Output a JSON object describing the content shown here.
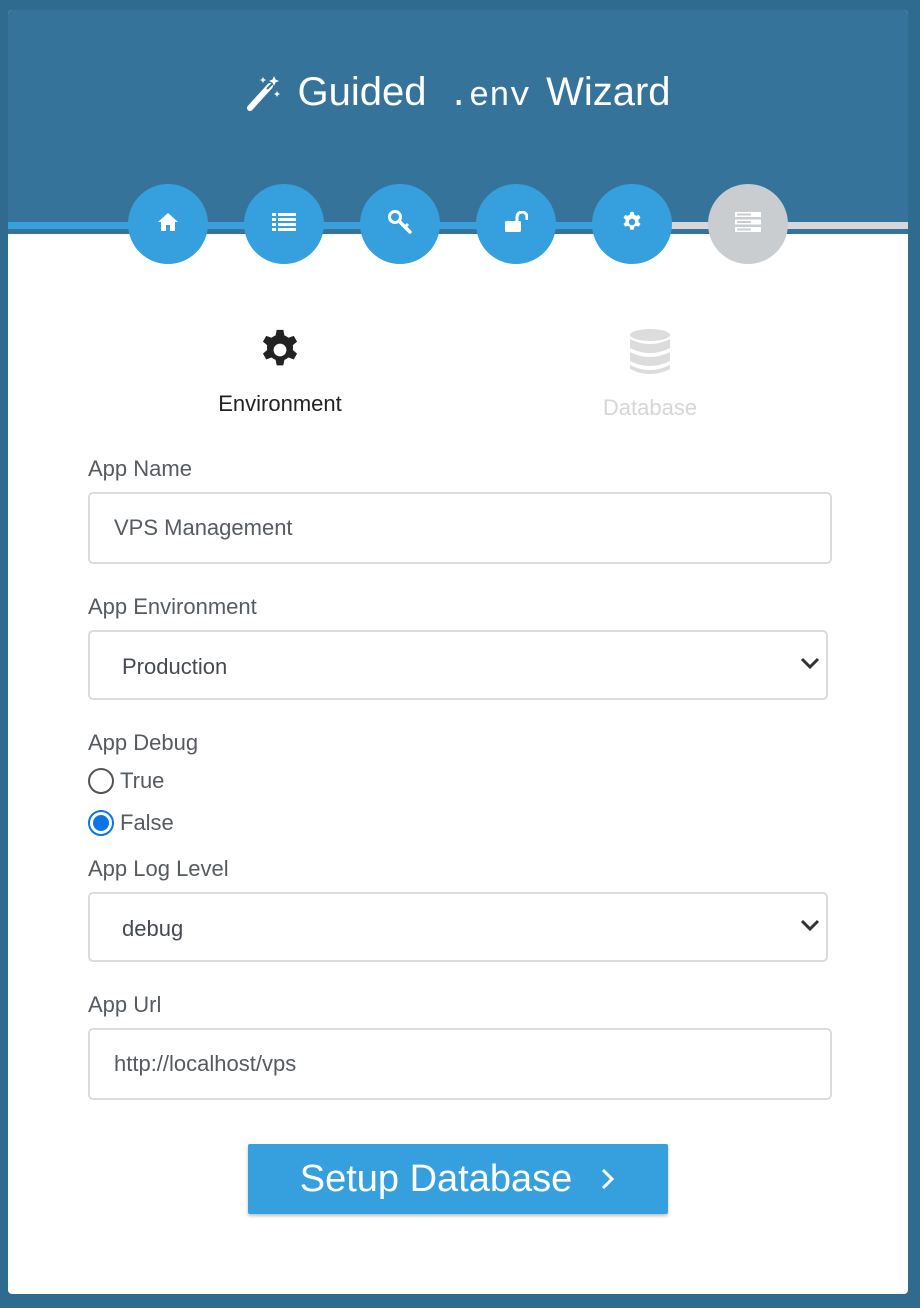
{
  "header": {
    "title_prefix": "Guided",
    "title_env": ".env",
    "title_suffix": "Wizard",
    "wand_icon": "magic-wand-icon"
  },
  "progress": {
    "completed_color": "#3aa0dc",
    "pending_color": "#d5d8da",
    "steps": [
      {
        "icon": "home-icon",
        "state": "done"
      },
      {
        "icon": "list-icon",
        "state": "done"
      },
      {
        "icon": "key-icon",
        "state": "done"
      },
      {
        "icon": "unlock-icon",
        "state": "done"
      },
      {
        "icon": "gear-icon",
        "state": "done"
      },
      {
        "icon": "server-icon",
        "state": "current"
      }
    ]
  },
  "subtabs": [
    {
      "label": "Environment",
      "icon": "gear-icon",
      "active": true
    },
    {
      "label": "Database",
      "icon": "database-icon",
      "active": false
    }
  ],
  "form": {
    "app_name": {
      "label": "App Name",
      "value": "VPS Management"
    },
    "app_environment": {
      "label": "App Environment",
      "selected": "Production"
    },
    "app_debug": {
      "label": "App Debug",
      "options": [
        {
          "label": "True",
          "checked": false
        },
        {
          "label": "False",
          "checked": true
        }
      ]
    },
    "app_log_level": {
      "label": "App Log Level",
      "selected": "debug"
    },
    "app_url": {
      "label": "App Url",
      "value": "http://localhost/vps"
    }
  },
  "submit": {
    "label": "Setup Database",
    "icon": "chevron-right-icon"
  },
  "colors": {
    "header_bg": "#36739a",
    "accent": "#36a0de",
    "page_bg": "#2f6a8f"
  }
}
